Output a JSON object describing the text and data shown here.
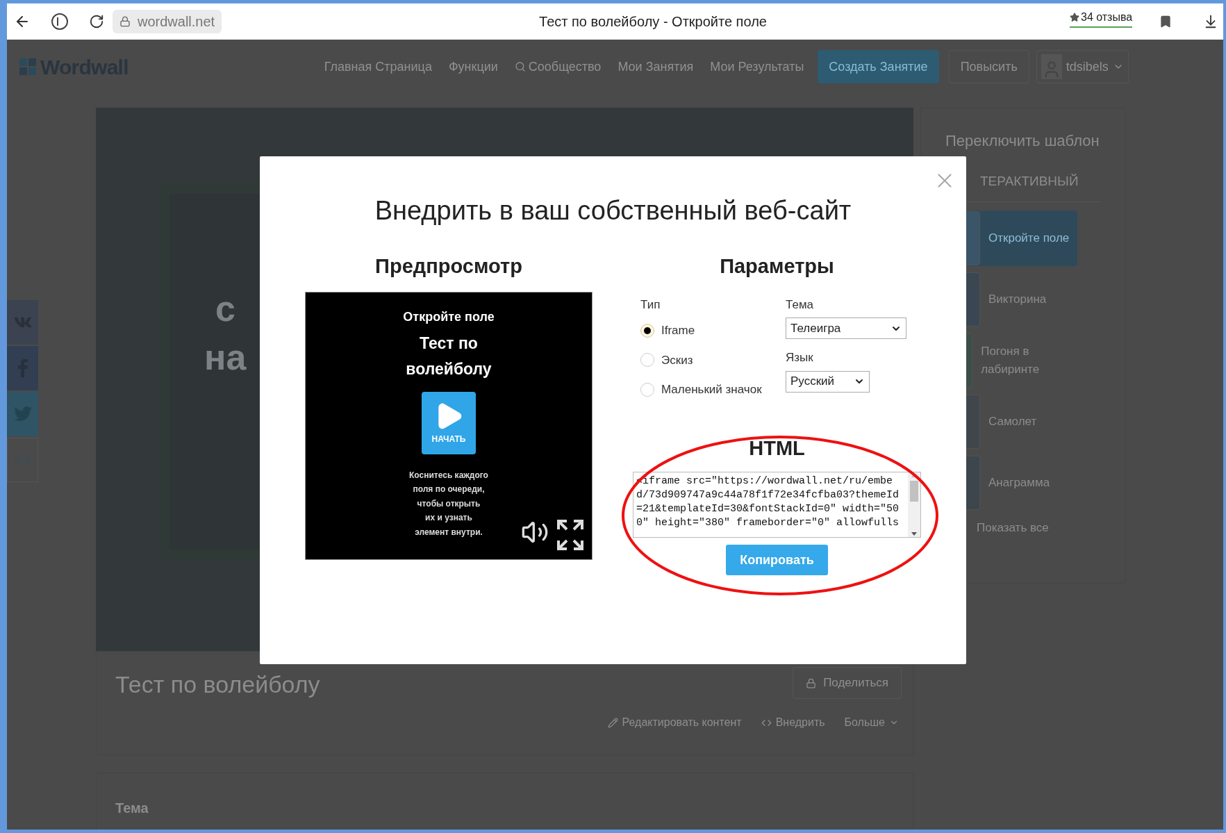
{
  "browser": {
    "url": "wordwall.net",
    "title": "Тест по волейболу - Откройте поле",
    "rating": "34 отзыва"
  },
  "nav": {
    "logo": "Wordwall",
    "items": [
      {
        "label": "Главная Страница",
        "kind": "link"
      },
      {
        "label": "Функции",
        "kind": "link"
      },
      {
        "label": "Сообщество",
        "kind": "search"
      },
      {
        "label": "Мои Занятия",
        "kind": "link"
      },
      {
        "label": "Мои Результаты",
        "kind": "link"
      }
    ],
    "create": "Создать Занятие",
    "upgrade": "Повысить",
    "user": "tdsibels"
  },
  "social": [
    {
      "kind": "vk"
    },
    {
      "kind": "facebook"
    },
    {
      "kind": "twitter"
    },
    {
      "kind": "embed"
    }
  ],
  "game": {
    "fragments": [
      "с",
      "на"
    ]
  },
  "activity": {
    "title": "Тест по волейболу",
    "share": "Поделиться",
    "actions": [
      {
        "label": "Редактировать контент",
        "kind": "edit"
      },
      {
        "label": "Внедрить",
        "kind": "embed"
      },
      {
        "label": "Больше",
        "kind": "more"
      }
    ]
  },
  "theme_card": {
    "label": "Тема"
  },
  "sidebar": {
    "title": "Переключить шаблон",
    "section": "ТЕРАКТИВНЫЙ",
    "templates": [
      {
        "label": "Откройте поле",
        "selected": true
      },
      {
        "label": "Викторина",
        "selected": false
      },
      {
        "label": "Погоня в лабиринте",
        "selected": false
      },
      {
        "label": "Самолет",
        "selected": false
      },
      {
        "label": "Анаграмма",
        "selected": false
      }
    ],
    "show_all": "Показать все"
  },
  "modal": {
    "title": "Внедрить в ваш собственный веб-сайт",
    "preview": {
      "heading": "Предпросмотр",
      "template": "Откройте поле",
      "activity_title": "Тест по волейболу",
      "start": "НАЧАТЬ",
      "instructions": "Коснитесь каждого\nполя по очереди,\nчтобы открыть\nих и узнать\nэлемент внутри."
    },
    "params": {
      "heading": "Параметры",
      "type_label": "Тип",
      "types": [
        {
          "label": "Iframe",
          "selected": true
        },
        {
          "label": "Эскиз",
          "selected": false
        },
        {
          "label": "Маленький значок",
          "selected": false
        }
      ],
      "theme_label": "Тема",
      "theme_value": "Телеигра",
      "language_label": "Язык",
      "language_value": "Русский",
      "html_heading": "HTML",
      "html_code_lines": [
        "<iframe src=\"https://wordwall.net/ru/embe",
        "d/73d909747a9c44a78f1f72e34fcfba03?themeId",
        "=21&templateId=30&fontStackId=0\" width=\"50",
        "0\" height=\"380\" frameborder=\"0\" allowfulls"
      ],
      "copy": "Копировать"
    }
  }
}
